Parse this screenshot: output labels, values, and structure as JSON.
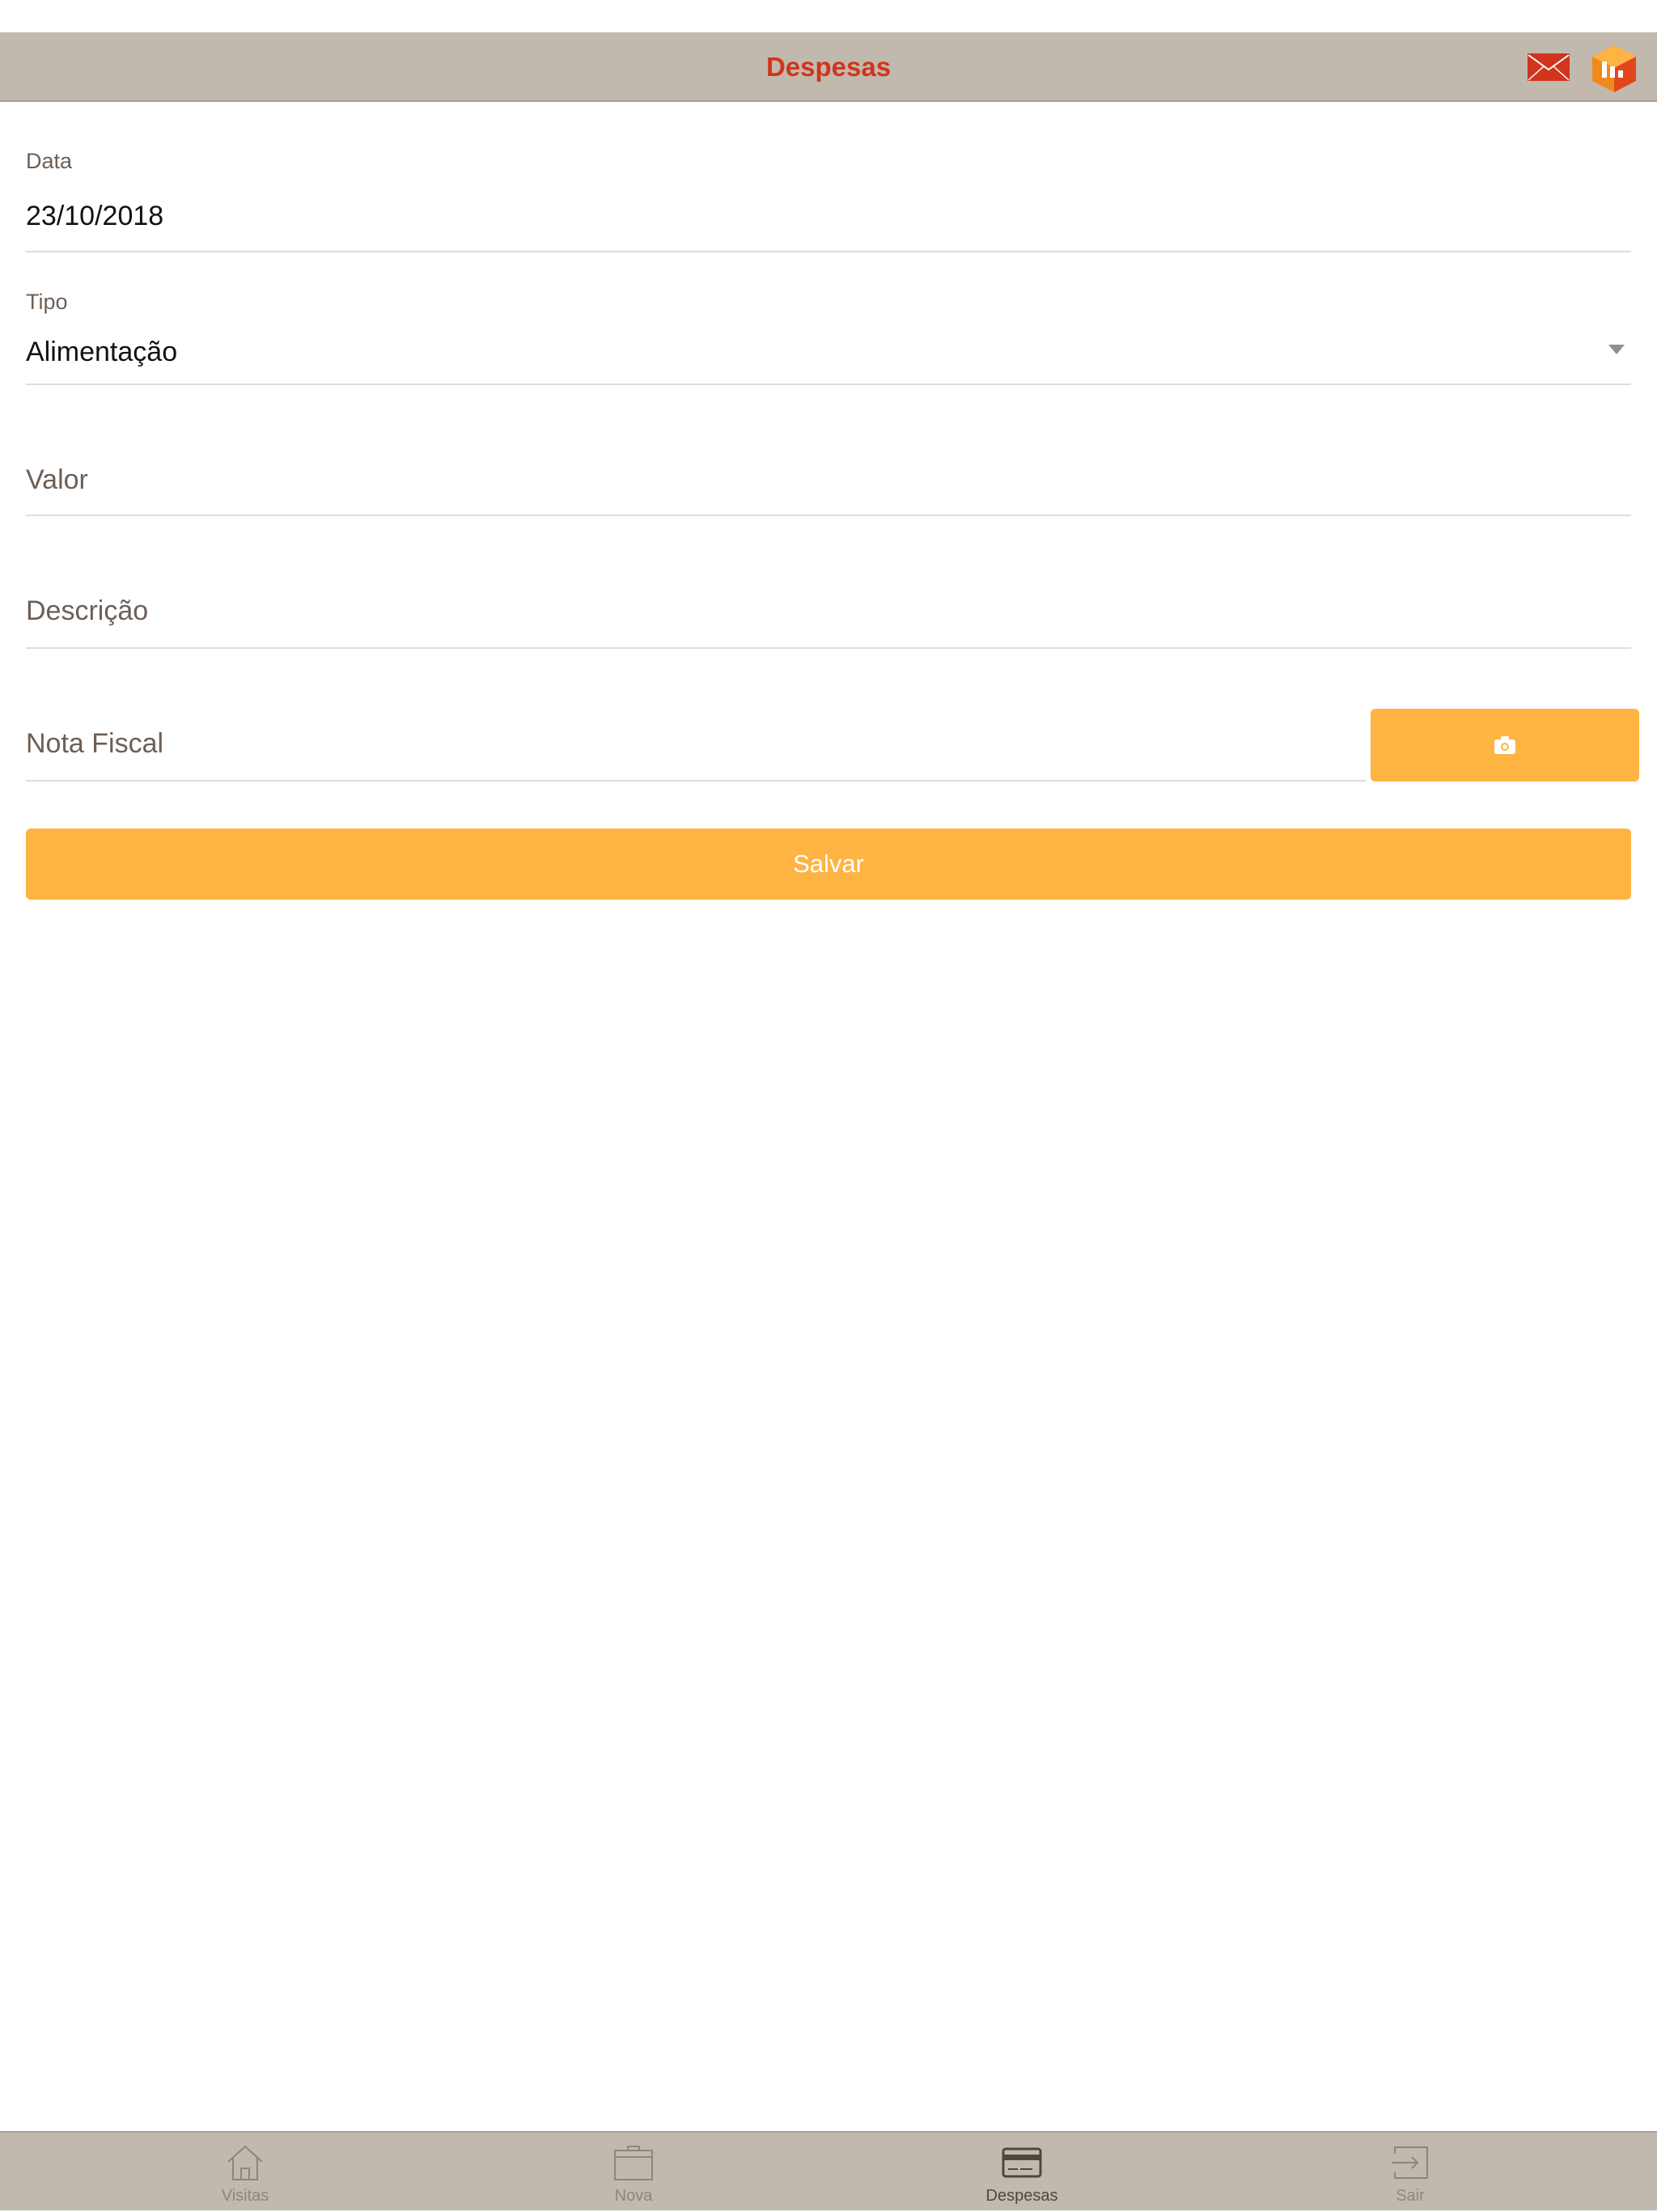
{
  "header": {
    "title": "Despesas",
    "icons": [
      "mail-icon",
      "app-logo-icon"
    ]
  },
  "form": {
    "data": {
      "label": "Data",
      "value": "23/10/2018"
    },
    "tipo": {
      "label": "Tipo",
      "value": "Alimentação"
    },
    "valor": {
      "placeholder": "Valor"
    },
    "descricao": {
      "placeholder": "Descrição"
    },
    "nota_fiscal": {
      "placeholder": "Nota Fiscal"
    },
    "camera_icon": "camera-icon",
    "save_label": "Salvar"
  },
  "tabs": [
    {
      "label": "Visitas",
      "icon": "home-icon",
      "active": false
    },
    {
      "label": "Nova",
      "icon": "briefcase-icon",
      "active": false
    },
    {
      "label": "Despesas",
      "icon": "credit-card-icon",
      "active": true
    },
    {
      "label": "Sair",
      "icon": "logout-icon",
      "active": false
    }
  ],
  "colors": {
    "bar_background": "#c2b9ae",
    "title_color": "#d0351d",
    "accent": "#ffb342"
  }
}
